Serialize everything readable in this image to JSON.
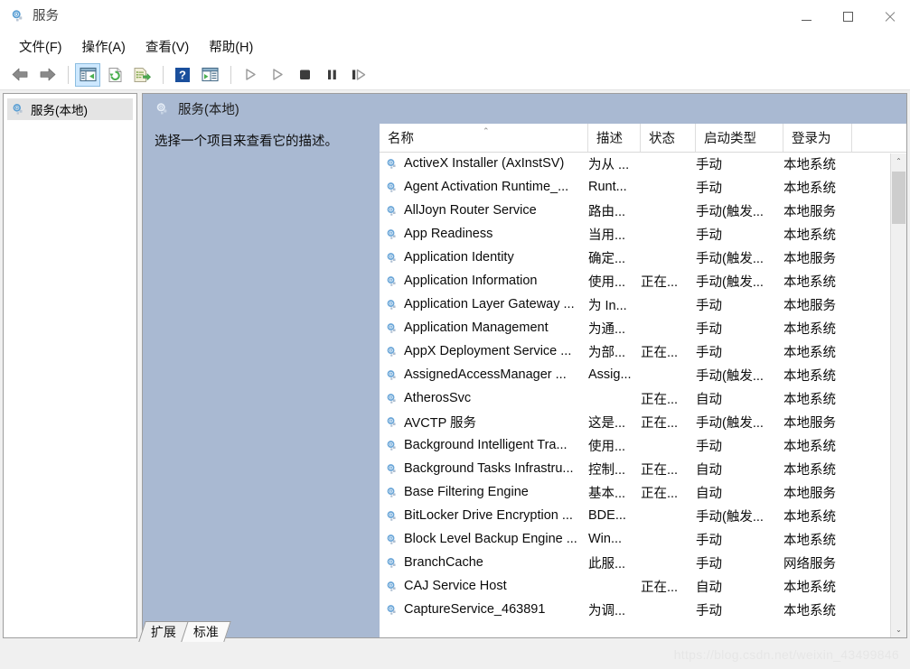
{
  "window": {
    "title": "服务",
    "icon": "services-gear-icon",
    "minimize_label": "最小化",
    "maximize_label": "最大化",
    "close_label": "关闭"
  },
  "menubar": {
    "items": [
      {
        "label": "文件(F)",
        "name": "menu-file"
      },
      {
        "label": "操作(A)",
        "name": "menu-action"
      },
      {
        "label": "查看(V)",
        "name": "menu-view"
      },
      {
        "label": "帮助(H)",
        "name": "menu-help"
      }
    ]
  },
  "toolbar": {
    "buttons": [
      {
        "name": "back-button",
        "icon": "arrow-left-icon",
        "selected": false
      },
      {
        "name": "forward-button",
        "icon": "arrow-right-icon",
        "selected": false
      },
      {
        "name": "separator-1",
        "icon": "separator",
        "selected": false
      },
      {
        "name": "show-hide-console-tree-button",
        "icon": "console-tree-icon",
        "selected": true
      },
      {
        "name": "refresh-button",
        "icon": "refresh-icon",
        "selected": false
      },
      {
        "name": "export-list-button",
        "icon": "export-list-icon",
        "selected": false
      },
      {
        "name": "separator-2",
        "icon": "separator",
        "selected": false
      },
      {
        "name": "help-button",
        "icon": "question-mark-icon",
        "selected": false
      },
      {
        "name": "properties-button",
        "icon": "properties-icon",
        "selected": false
      },
      {
        "name": "separator-3",
        "icon": "separator",
        "selected": false
      },
      {
        "name": "start-service-button",
        "icon": "play-icon",
        "selected": false
      },
      {
        "name": "resume-service-button",
        "icon": "play-outline-icon",
        "selected": false
      },
      {
        "name": "stop-service-button",
        "icon": "stop-icon",
        "selected": false
      },
      {
        "name": "pause-service-button",
        "icon": "pause-icon",
        "selected": false
      },
      {
        "name": "restart-service-button",
        "icon": "restart-icon",
        "selected": false
      }
    ]
  },
  "tree": {
    "root_label": "服务(本地)",
    "root_icon": "services-gear-icon"
  },
  "pane": {
    "header_title": "服务(本地)",
    "header_icon": "services-gear-icon",
    "description_placeholder": "选择一个项目来查看它的描述。"
  },
  "columns": [
    {
      "key": "name",
      "label": "名称",
      "sorted": true
    },
    {
      "key": "desc",
      "label": "描述",
      "sorted": false
    },
    {
      "key": "state",
      "label": "状态",
      "sorted": false
    },
    {
      "key": "start",
      "label": "启动类型",
      "sorted": false
    },
    {
      "key": "logon",
      "label": "登录为",
      "sorted": false
    }
  ],
  "sort_caret": "⌃",
  "rows": [
    {
      "name": "ActiveX Installer (AxInstSV)",
      "desc": "为从 ...",
      "state": "",
      "start": "手动",
      "logon": "本地系统"
    },
    {
      "name": "Agent Activation Runtime_...",
      "desc": "Runt...",
      "state": "",
      "start": "手动",
      "logon": "本地系统"
    },
    {
      "name": "AllJoyn Router Service",
      "desc": "路由...",
      "state": "",
      "start": "手动(触发...",
      "logon": "本地服务"
    },
    {
      "name": "App Readiness",
      "desc": "当用...",
      "state": "",
      "start": "手动",
      "logon": "本地系统"
    },
    {
      "name": "Application Identity",
      "desc": "确定...",
      "state": "",
      "start": "手动(触发...",
      "logon": "本地服务"
    },
    {
      "name": "Application Information",
      "desc": "使用...",
      "state": "正在...",
      "start": "手动(触发...",
      "logon": "本地系统"
    },
    {
      "name": "Application Layer Gateway ...",
      "desc": "为 In...",
      "state": "",
      "start": "手动",
      "logon": "本地服务"
    },
    {
      "name": "Application Management",
      "desc": "为通...",
      "state": "",
      "start": "手动",
      "logon": "本地系统"
    },
    {
      "name": "AppX Deployment Service ...",
      "desc": "为部...",
      "state": "正在...",
      "start": "手动",
      "logon": "本地系统"
    },
    {
      "name": "AssignedAccessManager ...",
      "desc": "Assig...",
      "state": "",
      "start": "手动(触发...",
      "logon": "本地系统"
    },
    {
      "name": "AtherosSvc",
      "desc": "",
      "state": "正在...",
      "start": "自动",
      "logon": "本地系统"
    },
    {
      "name": "AVCTP 服务",
      "desc": "这是...",
      "state": "正在...",
      "start": "手动(触发...",
      "logon": "本地服务"
    },
    {
      "name": "Background Intelligent Tra...",
      "desc": "使用...",
      "state": "",
      "start": "手动",
      "logon": "本地系统"
    },
    {
      "name": "Background Tasks Infrastru...",
      "desc": "控制...",
      "state": "正在...",
      "start": "自动",
      "logon": "本地系统"
    },
    {
      "name": "Base Filtering Engine",
      "desc": "基本...",
      "state": "正在...",
      "start": "自动",
      "logon": "本地服务"
    },
    {
      "name": "BitLocker Drive Encryption ...",
      "desc": "BDE...",
      "state": "",
      "start": "手动(触发...",
      "logon": "本地系统"
    },
    {
      "name": "Block Level Backup Engine ...",
      "desc": "Win...",
      "state": "",
      "start": "手动",
      "logon": "本地系统"
    },
    {
      "name": "BranchCache",
      "desc": "此服...",
      "state": "",
      "start": "手动",
      "logon": "网络服务"
    },
    {
      "name": "CAJ Service Host",
      "desc": "",
      "state": "正在...",
      "start": "自动",
      "logon": "本地系统"
    },
    {
      "name": "CaptureService_463891",
      "desc": "为调...",
      "state": "",
      "start": "手动",
      "logon": "本地系统"
    }
  ],
  "scrollbar": {
    "up_arrow": "⌃",
    "down_arrow": "⌄"
  },
  "tabs": [
    {
      "label": "扩展",
      "name": "tab-extended",
      "active": false
    },
    {
      "label": "标准",
      "name": "tab-standard",
      "active": true
    }
  ],
  "watermark": "https://blog.csdn.net/weixin_43499846",
  "colors": {
    "pane_header": "#a9b9d2",
    "toolbar_selected": "#cde8ff",
    "window_bg": "#f0f0f0"
  }
}
